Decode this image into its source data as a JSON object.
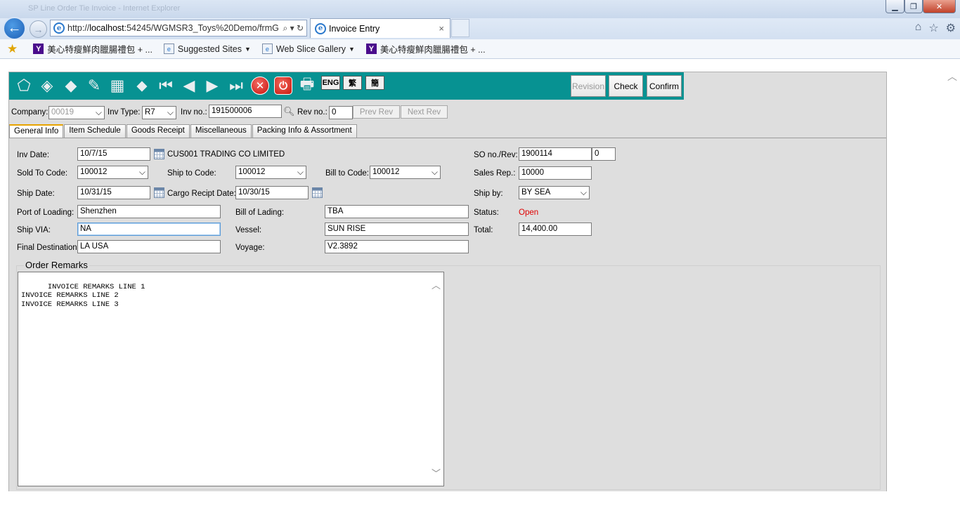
{
  "browser": {
    "window_title_ghost": "SP Line Order Tie Invoice - Internet Explorer",
    "address": {
      "prefix": "http://",
      "host": "localhost",
      "rest": ":54245/WGMSR3_Toys%20Demo/frmG",
      "controls": "⌕ ▾ ↻"
    },
    "tab": {
      "title": "Invoice Entry",
      "close": "×"
    },
    "favorites": [
      {
        "label": "美心特瘦鮮肉臘腸禮包 + ...",
        "icon": "yahoo-icon"
      },
      {
        "label": "Suggested Sites",
        "icon": "page-icon",
        "dropdown": true
      },
      {
        "label": "Web Slice Gallery",
        "icon": "page-icon",
        "dropdown": true
      },
      {
        "label": "美心特瘦鮮肉臘腸禮包 + ...",
        "icon": "yahoo-icon"
      }
    ]
  },
  "toolbar": {
    "lang": [
      "ENG",
      "繁",
      "簡"
    ],
    "revision": "Revision",
    "check": "Check",
    "confirm": "Confirm"
  },
  "header": {
    "company_label": "Company:",
    "company_value": "00019",
    "invtype_label": "Inv Type:",
    "invtype_value": "R7",
    "invno_label": "Inv no.:",
    "invno_value": "191500006",
    "revno_label": "Rev no.:",
    "revno_value": "0",
    "prev_rev": "Prev Rev",
    "next_rev": "Next Rev"
  },
  "tabs": [
    "General Info",
    "Item Schedule",
    "Goods Receipt",
    "Miscellaneous",
    "Packing Info & Assortment"
  ],
  "form": {
    "inv_date_label": "Inv Date:",
    "inv_date": "10/7/15",
    "customer_name": "CUS001 TRADING CO LIMITED",
    "so_label": "SO no./Rev:",
    "so_no": "1900114",
    "so_rev": "0",
    "sold_to_label": "Sold To Code:",
    "sold_to": "100012",
    "ship_to_label": "Ship to Code:",
    "ship_to": "100012",
    "bill_to_label": "Bill to Code:",
    "bill_to": "100012",
    "sales_rep_label": "Sales Rep.:",
    "sales_rep": "10000",
    "ship_date_label": "Ship Date:",
    "ship_date": "10/31/15",
    "cargo_label": "Cargo Recipt Date:",
    "cargo_date": "10/30/15",
    "ship_by_label": "Ship by:",
    "ship_by": "BY SEA",
    "port_label": "Port of Loading:",
    "port": "Shenzhen",
    "bol_label": "Bill of Lading:",
    "bol": "TBA",
    "status_label": "Status:",
    "status": "Open",
    "via_label": "Ship VIA:",
    "via": "NA",
    "vessel_label": "Vessel:",
    "vessel": "SUN RISE",
    "total_label": "Total:",
    "total": "14,400.00",
    "dest_label": "Final Destination",
    "dest": "LA USA",
    "voyage_label": "Voyage:",
    "voyage": "V2.3892",
    "remarks_legend": "Order Remarks",
    "remarks": "INVOICE REMARKS LINE 1\nINVOICE REMARKS LINE 2\nINVOICE REMARKS LINE 3"
  },
  "colors": {
    "toolbar": "#079292",
    "status_open": "#e00000",
    "tab_accent": "#e8a400"
  }
}
